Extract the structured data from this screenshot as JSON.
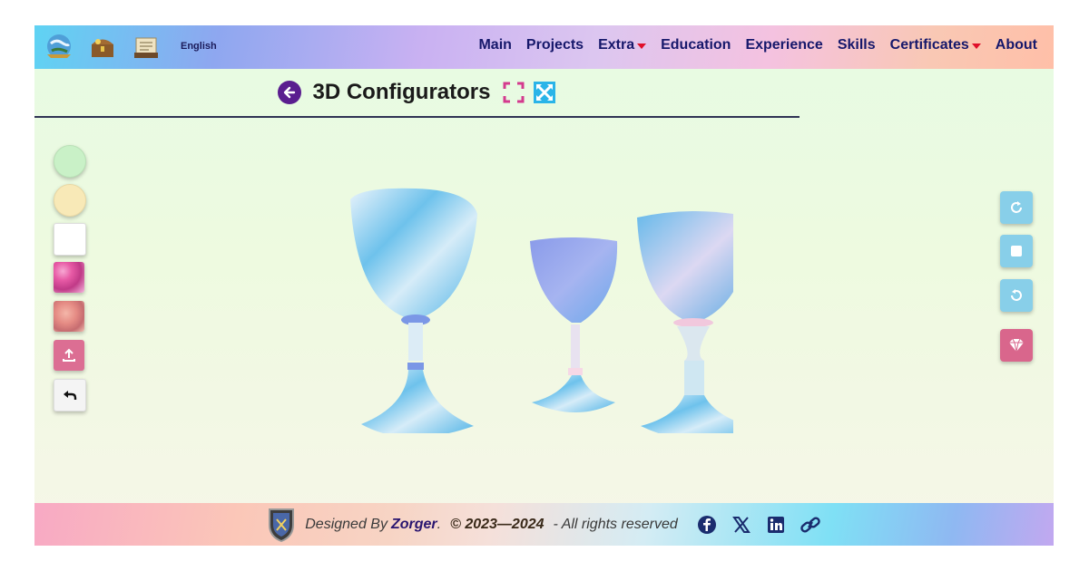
{
  "header": {
    "language": "English",
    "nav": [
      {
        "label": "Main",
        "dropdown": false
      },
      {
        "label": "Projects",
        "dropdown": false
      },
      {
        "label": "Extra",
        "dropdown": true
      },
      {
        "label": "Education",
        "dropdown": false
      },
      {
        "label": "Experience",
        "dropdown": false
      },
      {
        "label": "Skills",
        "dropdown": false
      },
      {
        "label": "Certificates",
        "dropdown": true
      },
      {
        "label": "About",
        "dropdown": false
      }
    ],
    "icons": [
      "globe-logo-icon",
      "treasure-chest-icon",
      "scroll-book-icon"
    ]
  },
  "page": {
    "title": "3D Configurators",
    "back_icon": "arrow-left-circle-icon",
    "fullscreen_icon": "fullscreen-corners-icon",
    "expand_icon": "expand-arrows-icon"
  },
  "left_tools": [
    {
      "name": "swatch-mint-green",
      "color": "#c9f1c7"
    },
    {
      "name": "swatch-cream-yellow",
      "color": "#f8e9b7"
    },
    {
      "name": "swatch-white",
      "color": "#ffffff"
    },
    {
      "name": "swatch-pink-pattern",
      "texture": "pink-floral"
    },
    {
      "name": "swatch-rose-pattern",
      "texture": "roses"
    },
    {
      "name": "upload-button",
      "icon": "upload-icon"
    },
    {
      "name": "undo-button",
      "icon": "undo-arrow-icon"
    }
  ],
  "right_tools": [
    {
      "name": "rotate-clockwise-button",
      "icon": "rotate-cw-icon"
    },
    {
      "name": "stop-button",
      "icon": "stop-square-icon"
    },
    {
      "name": "rotate-counterclockwise-button",
      "icon": "rotate-ccw-icon"
    },
    {
      "name": "gem-button",
      "icon": "diamond-icon"
    }
  ],
  "viewport": {
    "objects": [
      "goblet-left",
      "goblet-center",
      "goblet-right"
    ],
    "material": "sky-cloud-texture"
  },
  "footer": {
    "designed_by": "Designed By",
    "designer": "Zorger",
    "period": ".",
    "copyright": "© 2023—2024",
    "rights": "- All rights reserved",
    "social": [
      "facebook-icon",
      "x-icon",
      "linkedin-icon",
      "link-icon"
    ]
  },
  "colors": {
    "nav_text": "#16186b",
    "caret": "#e0102a",
    "back_button": "#5a1d8f",
    "right_button": "#88cfe9",
    "accent_pink": "#d9668c"
  }
}
